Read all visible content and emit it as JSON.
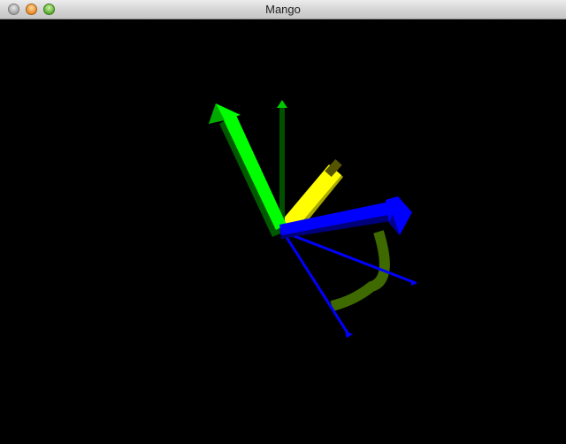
{
  "window": {
    "title": "Mango",
    "controls": {
      "close": "close-icon",
      "minimize": "minimize-icon",
      "zoom": "zoom-icon"
    }
  },
  "scene": {
    "background": "#000000",
    "colors": {
      "green_axis": "#00ff00",
      "dark_green_axis": "#005a00",
      "yellow_axis": "#ffff00",
      "blue_axis": "#0000ff",
      "arc": "#4a7a00"
    }
  }
}
